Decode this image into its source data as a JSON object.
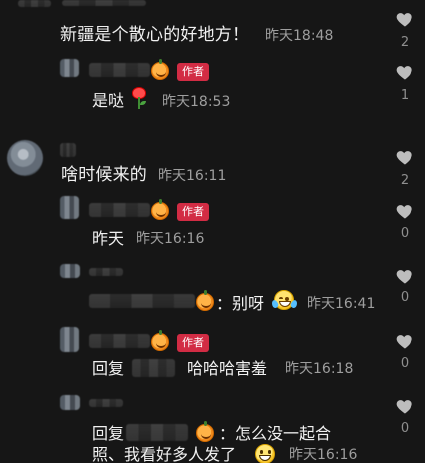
{
  "comments": [
    {
      "text": "新疆是个散心的好地方！",
      "time": "昨天18:48",
      "like_count": "2"
    },
    {
      "text": "是哒",
      "time": "昨天18:53",
      "badge": "作者",
      "like_count": "1"
    },
    {
      "text": "啥时候来的",
      "time": "昨天16:11",
      "like_count": "2"
    },
    {
      "text": "昨天",
      "time": "昨天16:16",
      "badge": "作者",
      "like_count": "0"
    },
    {
      "text": "：别呀",
      "time": "昨天16:41",
      "like_count": "0"
    },
    {
      "prefix": "回复",
      "text": "哈哈哈害羞",
      "time": "昨天16:18",
      "badge": "作者",
      "like_count": "0"
    },
    {
      "prefix": "回复",
      "line1": "：怎么没一起合",
      "line2": "照、我看好多人发了",
      "time": "昨天16:16",
      "like_count": "0"
    }
  ],
  "icons": {
    "heart": "heart-icon",
    "pumpkin": "pumpkin-emoji-icon",
    "rose": "rose-emoji-icon",
    "laugh": "tears-of-joy-emoji-icon",
    "grin": "grinning-emoji-icon"
  },
  "colors": {
    "background": "#161616",
    "text_primary": "#f1f1f1",
    "text_secondary": "#9e9e9e",
    "author_badge": "#d22c44"
  }
}
